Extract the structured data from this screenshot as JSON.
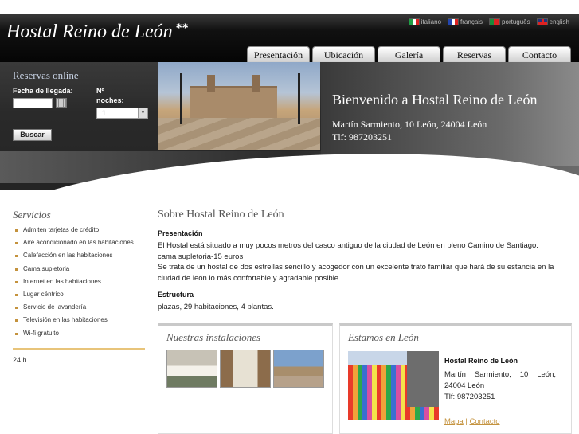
{
  "header": {
    "title": "Hostal Reino de León",
    "stars": "**",
    "languages": [
      {
        "label": "italiano",
        "flag": "flag-italy-icon"
      },
      {
        "label": "français",
        "flag": "flag-france-icon"
      },
      {
        "label": "português",
        "flag": "flag-portugal-icon"
      },
      {
        "label": "english",
        "flag": "flag-uk-icon"
      }
    ],
    "nav": [
      "Presentación",
      "Ubicación",
      "Galería",
      "Reservas",
      "Contacto"
    ]
  },
  "booking": {
    "title": "Reservas online",
    "date_label": "Fecha de llegada:",
    "date_value": "",
    "nights_label_1": "Nº",
    "nights_label_2": "noches:",
    "nights_value": "1",
    "search_label": "Buscar"
  },
  "banner": {
    "welcome": "Bienvenido a Hostal Reino de León",
    "address_line": "Martín Sarmiento, 10 León, 24004 León",
    "phone_line": "Tlf: 987203251"
  },
  "sidebar": {
    "title": "Servicios",
    "services": [
      "Admiten tarjetas de crédito",
      "Aire acondicionado en las habitaciones",
      "Calefacción en las habitaciones",
      "Cama supletoria",
      "Internet en las habitaciones",
      "Lugar céntrico",
      "Servicio de lavandería",
      "Televisión en las habitaciones",
      "Wi-fi gratuito"
    ],
    "footer": "24 h"
  },
  "main": {
    "title": "Sobre Hostal Reino de León",
    "presentation_heading": "Presentación",
    "presentation_text_1": "El Hostal está situado a muy pocos metros del casco antiguo de la ciudad de León en pleno Camino de Santiago.",
    "presentation_text_2": "cama supletoria-15 euros",
    "presentation_text_3": "Se trata de un hostal de dos estrellas sencillo y acogedor con un excelente trato familiar que hará de su estancia en la ciudad de león lo más confortable y agradable posible.",
    "structure_heading": "Estructura",
    "structure_text": "plazas, 29 habitaciones, 4 plantas."
  },
  "facilities": {
    "title": "Nuestras instalaciones"
  },
  "location": {
    "title": "Estamos en León",
    "name": "Hostal Reino de León",
    "address": "Martín Sarmiento, 10 León, 24004 León",
    "phone": "Tlf: 987203251",
    "map_link": "Mapa",
    "separator": "|",
    "contact_link": "Contacto"
  }
}
